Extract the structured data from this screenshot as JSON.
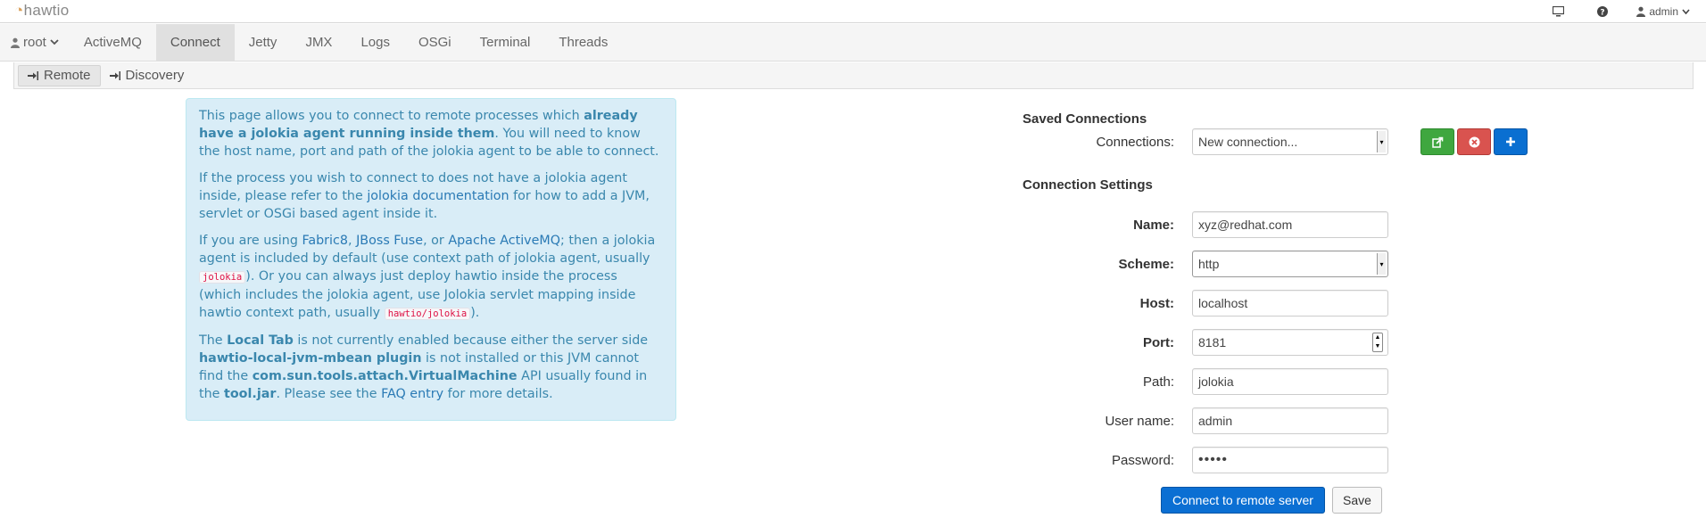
{
  "header": {
    "logo_text": "hawtio",
    "user_name": "admin"
  },
  "nav": {
    "root_label": "root",
    "items": [
      {
        "label": "ActiveMQ"
      },
      {
        "label": "Connect"
      },
      {
        "label": "Jetty"
      },
      {
        "label": "JMX"
      },
      {
        "label": "Logs"
      },
      {
        "label": "OSGi"
      },
      {
        "label": "Terminal"
      },
      {
        "label": "Threads"
      }
    ],
    "active": "Connect"
  },
  "subnav": {
    "tabs": [
      {
        "label": "Remote"
      },
      {
        "label": "Discovery"
      }
    ],
    "active": "Remote"
  },
  "info": {
    "p1": {
      "a": "This page allows you to connect to remote processes which ",
      "b": "already have a jolokia agent running inside them",
      "c": ". You will need to know the host name, port and path of the jolokia agent to be able to connect."
    },
    "p2": {
      "a": "If the process you wish to connect to does not have a jolokia agent inside, please refer to the ",
      "link": "jolokia documentation",
      "c": " for how to add a JVM, servlet or OSGi based agent inside it."
    },
    "p3": {
      "a": "If you are using ",
      "link1": "Fabric8",
      "sep1": ", ",
      "link2": "JBoss Fuse",
      "sep2": ", or ",
      "link3": "Apache ActiveMQ",
      "b": "; then a jolokia agent is included by default (use context path of jolokia agent, usually ",
      "code1": "jolokia",
      "c": "). Or you can always just deploy hawtio inside the process (which includes the jolokia agent, use Jolokia servlet mapping inside hawtio context path, usually ",
      "code2": "hawtio/jolokia",
      "d": ")."
    },
    "p4": {
      "a": "The ",
      "b1": "Local Tab",
      "c": " is not currently enabled because either the server side ",
      "b2": "hawtio-local-jvm-mbean plugin",
      "d": " is not installed or this JVM cannot find the ",
      "b3": "com.sun.tools.attach.VirtualMachine",
      "e": " API usually found in the ",
      "b4": "tool.jar",
      "f": ". Please see the ",
      "link": "FAQ entry",
      "g": " for more details."
    }
  },
  "saved": {
    "title": "Saved Connections",
    "connections_label": "Connections:",
    "connections_value": "New connection..."
  },
  "settings": {
    "title": "Connection Settings",
    "name_label": "Name:",
    "name_value": "xyz@redhat.com",
    "scheme_label": "Scheme:",
    "scheme_value": "http",
    "host_label": "Host:",
    "host_value": "localhost",
    "port_label": "Port:",
    "port_value": "8181",
    "path_label": "Path:",
    "path_value": "jolokia",
    "username_label": "User name:",
    "username_value": "admin",
    "password_label": "Password:",
    "password_value": "•••••"
  },
  "actions": {
    "connect_label": "Connect to remote server",
    "save_label": "Save"
  },
  "colors": {
    "info_bg": "#d9edf7",
    "info_text": "#3a87ad",
    "primary": "#0b6fd3",
    "success": "#3fa73f",
    "danger": "#d9534f"
  }
}
